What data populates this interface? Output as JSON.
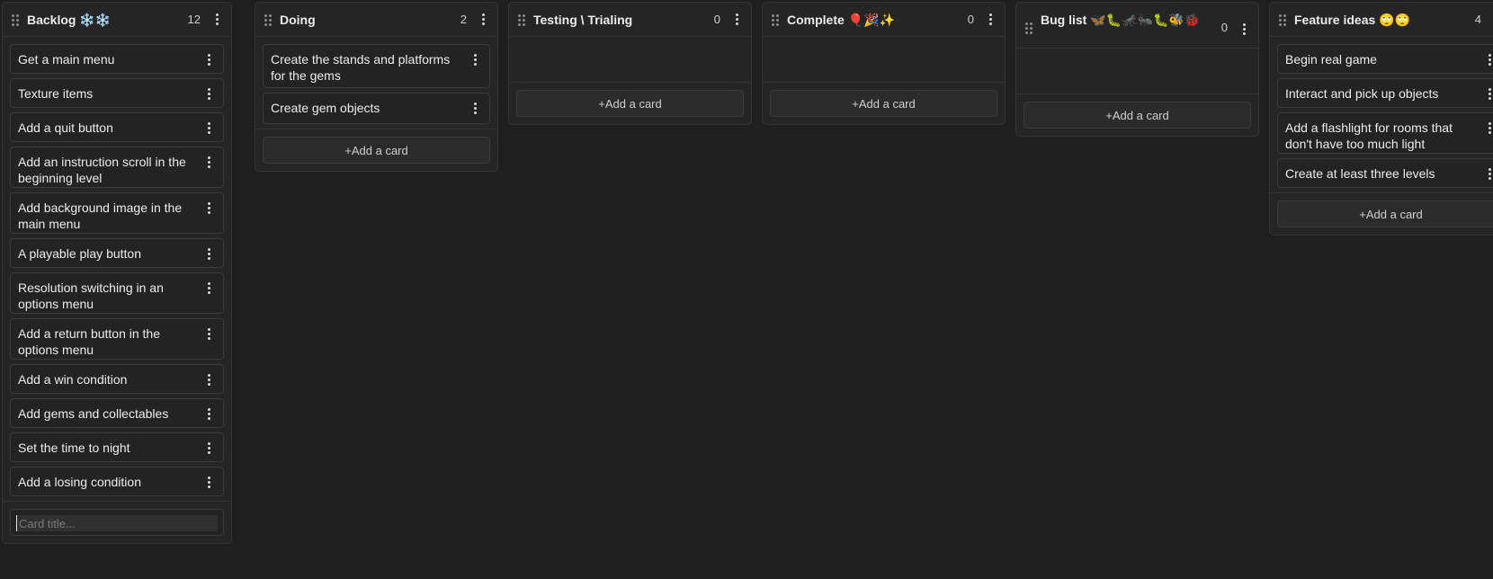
{
  "columns": [
    {
      "title": "Backlog ❄️❄️",
      "count": "12",
      "cards": [
        "Get a main menu",
        "Texture items",
        "Add a quit button",
        "Add an instruction scroll in the beginning level",
        "Add background image in the main menu",
        "A playable play button",
        "Resolution switching in an options menu",
        "Add a return button in the options menu",
        "Add a win condition",
        "Add gems and collectables",
        "Set the time to night",
        "Add a losing condition"
      ],
      "input_placeholder": "Card title..."
    },
    {
      "title": "Doing",
      "count": "2",
      "cards": [
        "Create the stands and platforms for the gems",
        "Create gem objects"
      ],
      "add_label": "+Add a card"
    },
    {
      "title": "Testing \\ Trialing",
      "count": "0",
      "cards": [],
      "add_label": "+Add a card"
    },
    {
      "title": "Complete 🎈🎉✨",
      "count": "0",
      "cards": [],
      "add_label": "+Add a card"
    },
    {
      "title": "Bug list 🦋🐛🦟🐜🐛🐝🐞",
      "count": "0",
      "cards": [],
      "add_label": "+Add a card"
    },
    {
      "title": "Feature ideas 🙄🙄",
      "count": "4",
      "cards": [
        "Begin real game",
        "Interact and pick up objects",
        "Add a flashlight for rooms that don't have too much light",
        "Create at least three levels"
      ],
      "add_label": "+Add a card"
    }
  ]
}
